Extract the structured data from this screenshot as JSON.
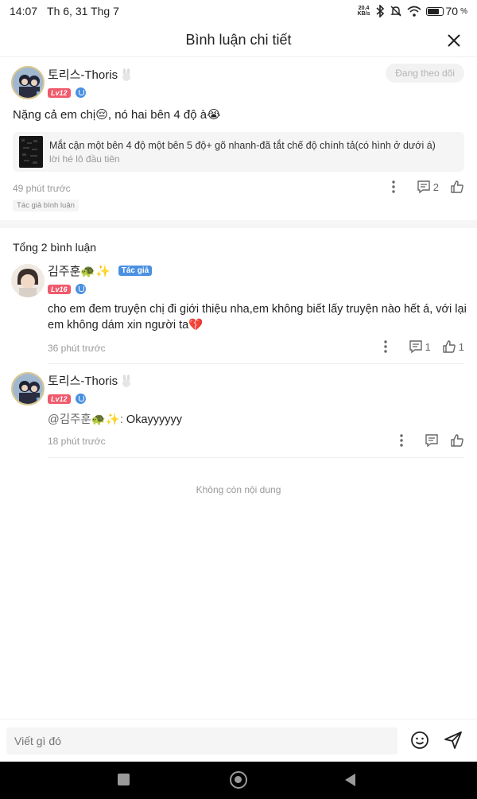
{
  "status_bar": {
    "time": "14:07",
    "date": "Th 6, 31 Thg 7",
    "net_speed_value": "20.4",
    "net_speed_unit": "KB/s",
    "battery": "70"
  },
  "header": {
    "title": "Bình luận chi tiết"
  },
  "main_comment": {
    "username": "토리스-Thoris",
    "level": "Lv12",
    "follow_label": "Đang theo dõi",
    "content": "Nặng cả em chị😔, nó hai bên 4 độ à😭",
    "quote_text": "Mắt cận một bên 4 độ một bên 5 độ+ gõ nhanh-đã tắt chế độ chính tả(có hình ở dưới á)",
    "quote_sub": "lời hé lô đầu tiên",
    "time": "49 phút trước",
    "reply_count": "2",
    "tag": "Tác giả bình luận"
  },
  "replies_header": "Tổng 2 bình luận",
  "replies": [
    {
      "username": "김주훈🐢✨",
      "author_badge": "Tác giả",
      "level": "Lv16",
      "content": "cho em đem truyện chị đi giới thiệu nha,em không biết lấy truyện nào hết á, với lại em không dám xin người ta💔",
      "time": "36 phút trước",
      "reply_count": "1",
      "like_count": "1"
    },
    {
      "username": "토리스-Thoris",
      "level": "Lv12",
      "mention": "@김주훈🐢✨:",
      "content": " Okayyyyyy",
      "time": "18 phút trước"
    }
  ],
  "footer_text": "Không còn nội dung",
  "input": {
    "placeholder": "Viết gì đó"
  },
  "colors": {
    "level": "#ef5a6c",
    "verify": "#4a90e2",
    "author_badge": "#4a90e2"
  }
}
